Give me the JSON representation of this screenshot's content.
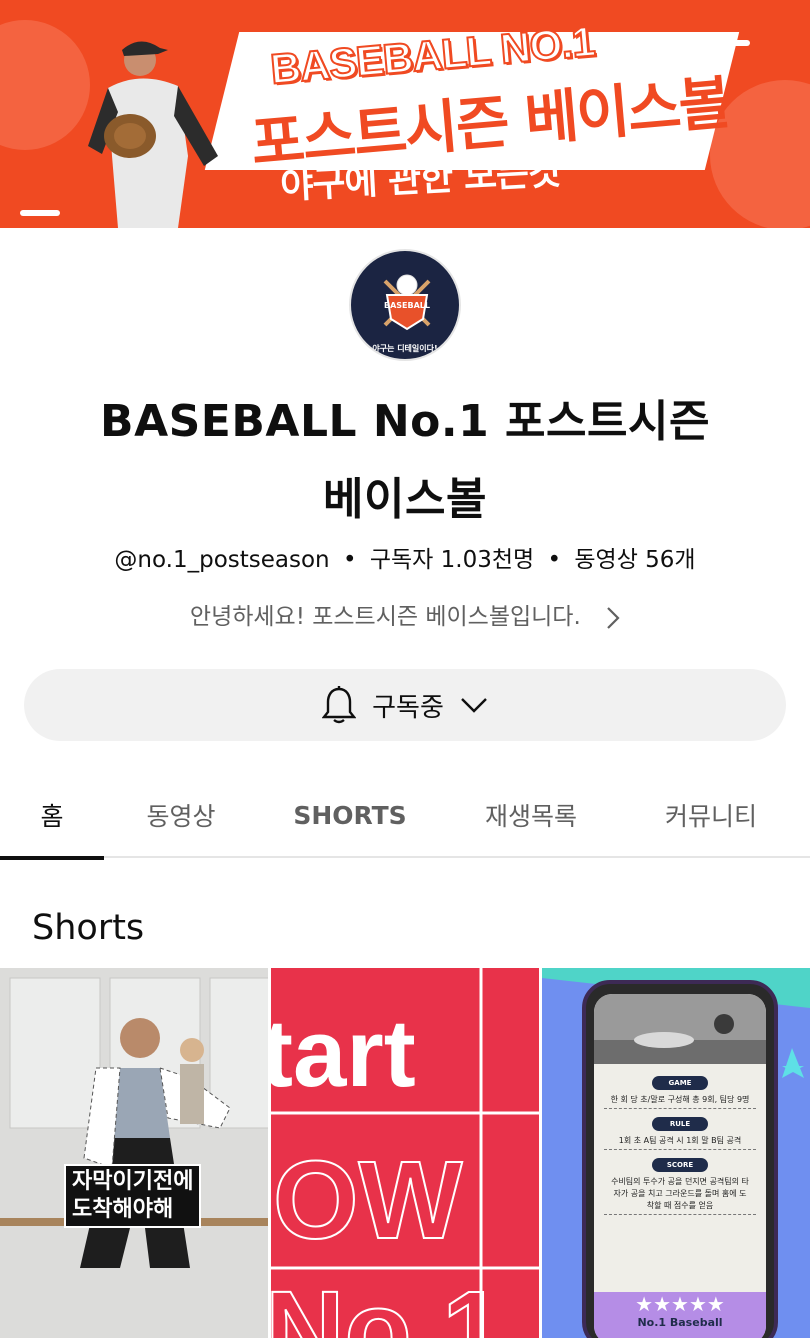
{
  "banner": {
    "line1": "BASEBALL NO.1",
    "line2": "포스트시즌 베이스볼",
    "line3": "야구에 관한 모든것"
  },
  "avatar": {
    "logo_text": "BASEBALL",
    "tagline": "야구는 디테일이다!"
  },
  "channel": {
    "title_line1": "BASEBALL No.1 포스트시즌",
    "title_line2": "베이스볼",
    "handle": "@no.1_postseason",
    "subscribers": "구독자 1.03천명",
    "videos": "동영상 56개",
    "separator": "•",
    "description": "안녕하세요! 포스트시즌 베이스볼입니다."
  },
  "subscribe_button": {
    "label": "구독중"
  },
  "tabs": [
    {
      "label": "홈",
      "active": true
    },
    {
      "label": "동영상"
    },
    {
      "label": "SHORTS"
    },
    {
      "label": "재생목록"
    },
    {
      "label": "커뮤니티"
    }
  ],
  "shorts": {
    "section_title": "Shorts",
    "items": [
      {
        "caption_line1": "자막이기전에",
        "caption_line2": "도착해야해"
      },
      {
        "text_top": "tart",
        "text_mid": "OW",
        "text_bot": "No.1"
      },
      {
        "labels": [
          "GAME",
          "RULE",
          "SCORE"
        ],
        "lines": [
          "한 회 당 초/말로 구성해 총 9회, 팀당 9명",
          "1회 초 A팀 공격 시 1회 말 B팀 공격",
          "수비팀의 투수가 공을 던지면 공격팀의 타자가 공을 치고 그라운드를 돌며 홈에 도착할 때 점수를 얻음"
        ],
        "stars": "★★★★★",
        "name": "No.1 Baseball"
      }
    ]
  },
  "colors": {
    "banner": "#f04a22",
    "text": "#0f0f0f",
    "secondary_text": "#606060",
    "button_bg": "#f1f1f1"
  }
}
